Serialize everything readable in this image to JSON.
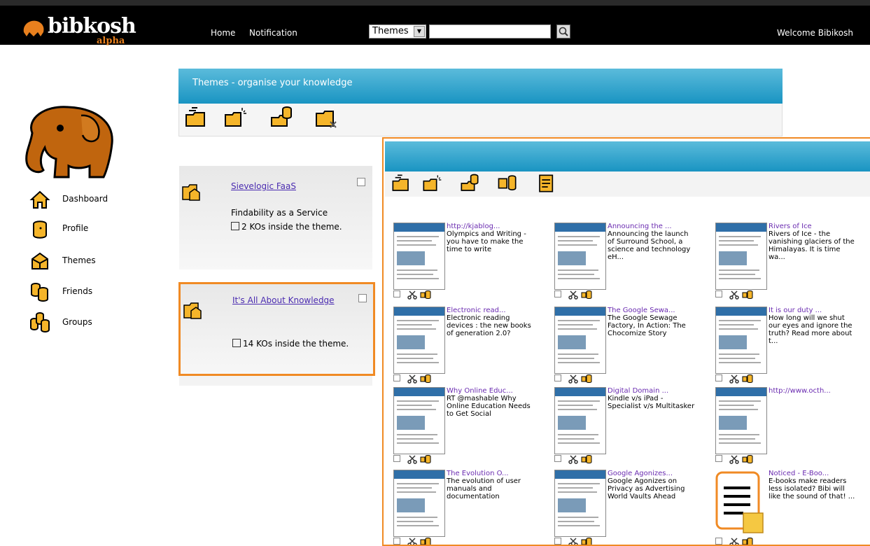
{
  "header": {
    "logo_text": "bibkosh",
    "logo_sub": "alpha",
    "nav": {
      "home": "Home",
      "notification": "Notification"
    },
    "search": {
      "select_value": "Themes",
      "placeholder": ""
    },
    "welcome": "Welcome Bibikosh"
  },
  "sidebar": {
    "items": [
      {
        "label": "Dashboard",
        "icon": "home-icon"
      },
      {
        "label": "Profile",
        "icon": "profile-icon"
      },
      {
        "label": "Themes",
        "icon": "themes-icon"
      },
      {
        "label": "Friends",
        "icon": "friends-icon"
      },
      {
        "label": "Groups",
        "icon": "groups-icon"
      }
    ]
  },
  "themes_panel": {
    "title": "Themes - organise your knowledge"
  },
  "themes": [
    {
      "title": "Sievelogic FaaS",
      "description": "Findability as a Service",
      "count": "2 KOs inside the theme."
    },
    {
      "title": "It's All About Knowledge",
      "description": "",
      "count": "14 KOs inside the theme."
    }
  ],
  "kos": [
    {
      "title": "http://kjablog...",
      "desc": "Olympics and Writing - you have to make the time to write"
    },
    {
      "title": "Announcing the ...",
      "desc": "Announcing the launch of Surround School, a science and technology eH..."
    },
    {
      "title": "Rivers of Ice",
      "desc": "Rivers of Ice - the vanishing glaciers of the Himalayas. It is time wa..."
    },
    {
      "title": "Electronic read...",
      "desc": "Electronic reading devices : the new books of generation 2.0?"
    },
    {
      "title": "The Google Sewa...",
      "desc": "The Google Sewage Factory, In Action: The Chocomize Story"
    },
    {
      "title": "It is our duty ...",
      "desc": "How long will we shut our eyes and ignore the truth? Read more about t..."
    },
    {
      "title": "Why Online Educ...",
      "desc": "RT @mashable Why Online Education Needs to Get Social"
    },
    {
      "title": "Digital Domain ...",
      "desc": "Kindle v/s iPad - Specialist v/s Multitasker"
    },
    {
      "title": "http://www.octh...",
      "desc": ""
    },
    {
      "title": "The Evolution O...",
      "desc": "The evolution of user manuals and documentation"
    },
    {
      "title": "Google Agonizes...",
      "desc": "Google Agonizes on Privacy as Advertising World Vaults Ahead"
    },
    {
      "title": "Noticed - E-Boo...",
      "desc": "E-books make readers less isolated? Bibi will like the sound of that! ..."
    }
  ]
}
